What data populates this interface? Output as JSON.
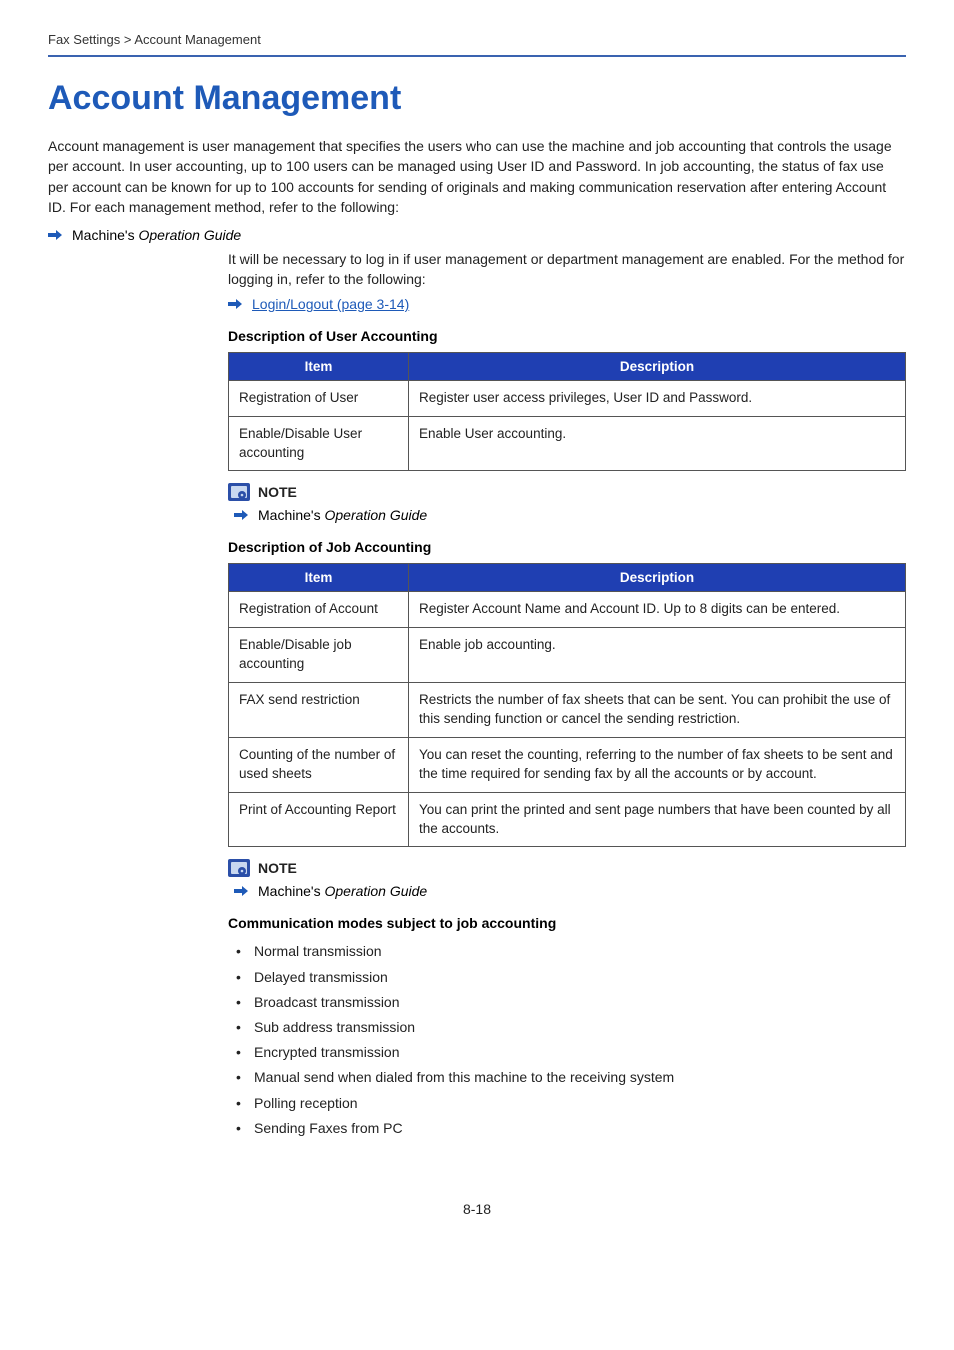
{
  "header": "Fax Settings > Account Management",
  "title": "Account Management",
  "intro": "Account management is user management that specifies the users who can use the machine and job accounting that controls the usage per account. In user accounting, up to 100 users can be managed using User ID and Password. In job accounting, the status of fax use per account can be known for up to 100 accounts for sending of originals and making communication reservation after entering Account ID. For each management method, refer to the following:",
  "ref_prefix": "Machine's ",
  "ref_italic": "Operation Guide",
  "login_intro": "It will be necessary to log in if user management or department management are enabled. For the method for logging in, refer to the following:",
  "login_link": "Login/Logout (page 3-14)",
  "table_headers": {
    "item": "Item",
    "desc": "Description"
  },
  "user_section_title": "Description of User Accounting",
  "user_table": [
    {
      "item": "Registration of User",
      "desc": "Register user access privileges, User ID and Password."
    },
    {
      "item": "Enable/Disable User accounting",
      "desc": "Enable User accounting."
    }
  ],
  "note_label": "NOTE",
  "job_section_title": "Description of Job Accounting",
  "job_table": [
    {
      "item": "Registration of Account",
      "desc": "Register Account Name and Account ID. Up to 8 digits can be entered."
    },
    {
      "item": "Enable/Disable job accounting",
      "desc": "Enable job accounting."
    },
    {
      "item": "FAX send restriction",
      "desc": "Restricts the number of fax sheets that can be sent. You can prohibit the use of this sending function or cancel the sending restriction."
    },
    {
      "item": "Counting of the number of used sheets",
      "desc": "You can reset the counting, referring to the number of fax sheets to be sent and the time required for sending fax by all the accounts or by account."
    },
    {
      "item": "Print of Accounting Report",
      "desc": "You can print the printed and sent page numbers that have been counted by all the accounts."
    }
  ],
  "modes_title": "Communication modes subject to job accounting",
  "modes": [
    "Normal transmission",
    "Delayed transmission",
    "Broadcast transmission",
    "Sub address transmission",
    "Encrypted transmission",
    "Manual send when dialed from this machine to the receiving system",
    "Polling reception",
    "Sending Faxes from PC"
  ],
  "page_number": "8-18"
}
